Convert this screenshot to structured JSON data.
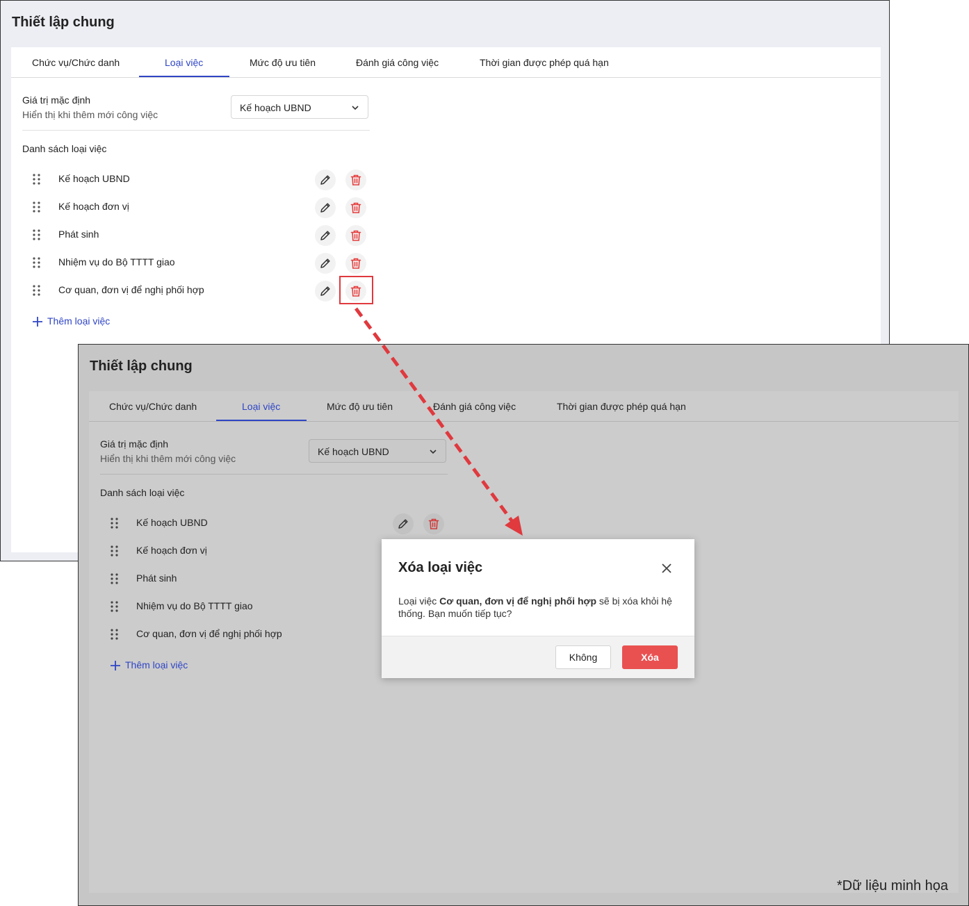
{
  "page_title": "Thiết lập chung",
  "tabs": [
    {
      "label": "Chức vụ/Chức danh"
    },
    {
      "label": "Loại việc"
    },
    {
      "label": "Mức độ ưu tiên"
    },
    {
      "label": "Đánh giá công việc"
    },
    {
      "label": "Thời gian được phép quá hạn"
    }
  ],
  "active_tab": "Loại việc",
  "default_value": {
    "label": "Giá trị mặc định",
    "hint": "Hiển thị khi thêm mới công việc",
    "selected": "Kế hoạch UBND"
  },
  "list": {
    "title": "Danh sách loại việc",
    "items": [
      {
        "label": "Kế hoạch UBND"
      },
      {
        "label": "Kế hoạch đơn vị"
      },
      {
        "label": "Phát sinh"
      },
      {
        "label": "Nhiệm vụ do Bộ TTTT giao"
      },
      {
        "label": "Cơ quan, đơn vị để nghị phối hợp"
      }
    ],
    "add_label": "Thêm loại việc"
  },
  "dialog": {
    "title": "Xóa loại việc",
    "message_prefix": "Loại việc ",
    "message_bold": "Cơ quan, đơn vị để nghị phối hợp",
    "message_suffix": " sẽ bị xóa khỏi hệ thống. Bạn muốn tiếp tục?",
    "cancel_label": "Không",
    "confirm_label": "Xóa"
  },
  "note": "*Dữ liệu minh họa",
  "colors": {
    "accent": "#2f45c5",
    "danger": "#e95151",
    "highlight": "#e0393e",
    "overlay": "#c6c6c6"
  },
  "icons": {
    "drag": "drag-handle-icon",
    "edit": "pencil-icon",
    "delete": "trash-icon",
    "add": "plus-icon",
    "dropdown": "chevron-down-icon",
    "close": "close-icon"
  }
}
